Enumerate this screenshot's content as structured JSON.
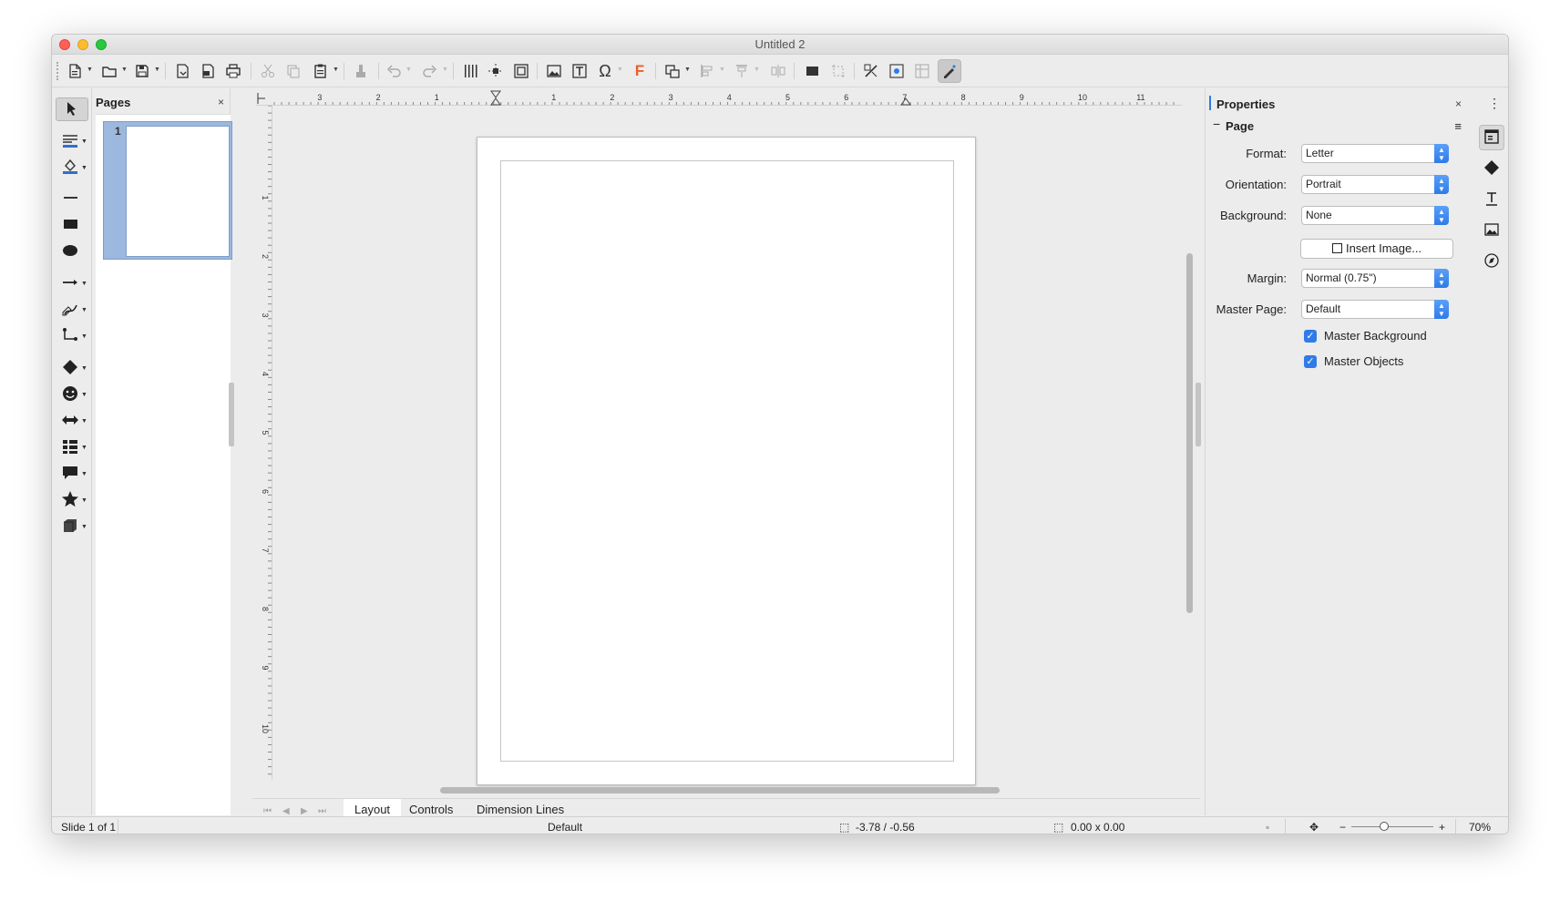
{
  "window": {
    "title": "Untitled 2"
  },
  "toolbar": {
    "icons": [
      "new-document-icon",
      "open-folder-icon",
      "save-icon",
      "export-icon",
      "export-pdf-icon",
      "print-icon",
      "cut-icon",
      "copy-icon",
      "paste-icon",
      "clone-formatting-icon",
      "undo-icon",
      "redo-icon",
      "grid-icon",
      "helplines-icon",
      "zoom-icon",
      "insert-image-icon",
      "insert-textbox-icon",
      "special-character-icon",
      "fontwork-icon",
      "transformations-icon",
      "align-icon",
      "arrange-icon",
      "distribute-icon",
      "shadow-icon",
      "crop-icon",
      "toggle-extrusion-icon",
      "glue-points-icon",
      "show-draw-functions-icon"
    ]
  },
  "left_tools": [
    "select-icon",
    "line-color-icon",
    "fill-color-icon",
    "line-icon",
    "rectangle-icon",
    "ellipse-icon",
    "lines-arrows-icon",
    "curves-polygons-icon",
    "connectors-icon",
    "basic-shapes-icon",
    "symbol-shapes-icon",
    "block-arrows-icon",
    "flowchart-icon",
    "callouts-icon",
    "stars-icon",
    "3d-objects-icon"
  ],
  "pages_panel": {
    "title": "Pages",
    "close": "×",
    "thumbnails": [
      {
        "number": "1"
      }
    ]
  },
  "ruler": {
    "h_ticks": [
      "3",
      "2",
      "1",
      "1",
      "2",
      "3",
      "4",
      "5",
      "6",
      "7",
      "8",
      "9",
      "10",
      "11"
    ],
    "v_ticks": [
      "1",
      "2",
      "3",
      "4",
      "5",
      "6",
      "7",
      "8",
      "9",
      "10"
    ]
  },
  "tabs": {
    "items": [
      {
        "label": "Layout",
        "active": true
      },
      {
        "label": "Controls",
        "active": false
      },
      {
        "label": "Dimension Lines",
        "active": false
      }
    ]
  },
  "statusbar": {
    "slide": "Slide 1 of 1",
    "master": "Default",
    "position": "-3.78 / -0.56",
    "size": "0.00 x 0.00",
    "zoom_minus": "−",
    "zoom_plus": "+",
    "zoom": "70%"
  },
  "properties": {
    "title": "Properties",
    "close": "×",
    "section": {
      "title": "Page",
      "collapse": "−",
      "menu": "≡"
    },
    "format": {
      "label": "Format:",
      "value": "Letter"
    },
    "orientation": {
      "label": "Orientation:",
      "value": "Portrait"
    },
    "background": {
      "label": "Background:",
      "value": "None"
    },
    "insert_image": "Insert Image...",
    "margin": {
      "label": "Margin:",
      "value": "Normal (0.75\")"
    },
    "master_page": {
      "label": "Master Page:",
      "value": "Default"
    },
    "master_background": {
      "label": "Master Background",
      "checked": true
    },
    "master_objects": {
      "label": "Master Objects",
      "checked": true
    },
    "more": "⋮"
  },
  "sidedeck": [
    "properties-icon",
    "shapes-icon",
    "styles-icon",
    "gallery-icon",
    "navigator-icon"
  ],
  "colors": {
    "accent": "#2f7be8",
    "thumb_select": "#9db8de"
  }
}
